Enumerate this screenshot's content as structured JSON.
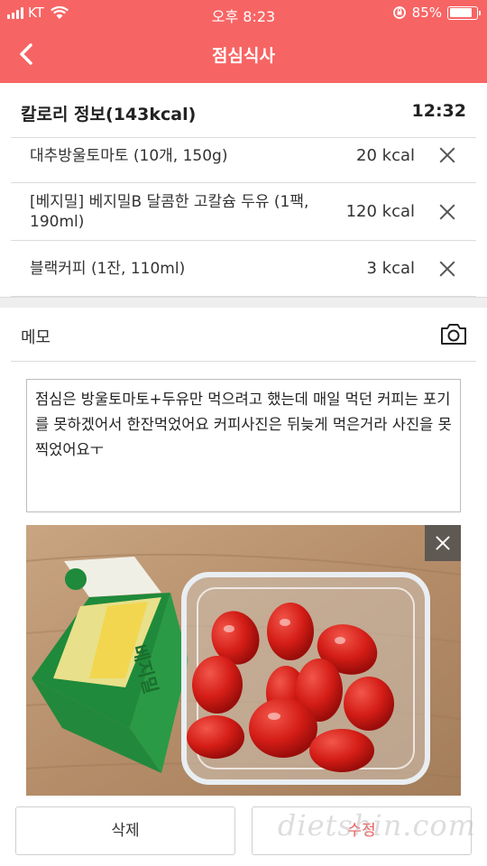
{
  "status_bar": {
    "carrier": "KT",
    "time": "오후 8:23",
    "battery_percent": "85%",
    "battery_level": 0.85,
    "icons": [
      "signal-icon",
      "wifi-icon",
      "orientation-lock-icon",
      "battery-icon"
    ]
  },
  "nav": {
    "title": "점심식사",
    "back_icon": "chevron-left-icon"
  },
  "calorie_info": {
    "label": "칼로리 정보(143kcal)",
    "time": "12:32"
  },
  "foods": [
    {
      "name": "대추방울토마토 (10개, 150g)",
      "kcal": "20 kcal"
    },
    {
      "name": "[베지밀] 베지밀B 달콤한 고칼슘 두유 (1팩, 190ml)",
      "kcal": "120 kcal"
    },
    {
      "name": "블랙커피 (1잔, 110ml)",
      "kcal": "3 kcal"
    }
  ],
  "memo": {
    "label": "메모",
    "camera_icon": "camera-icon",
    "text": "점심은 방울토마토+두유만 먹으려고 했는데 매일 먹던 커피는 포기를 못하겠어서 한잔먹었어요 커피사진은 뒤늦게 먹은거라 사진을 못찍었어요ㅜ"
  },
  "photo": {
    "close_icon": "close-icon",
    "carton_text": "베지밀"
  },
  "buttons": {
    "delete": "삭제",
    "edit": "수정"
  },
  "watermark": "dietshin.com",
  "colors": {
    "accent": "#f76464",
    "edit_text": "#f25a5a"
  }
}
